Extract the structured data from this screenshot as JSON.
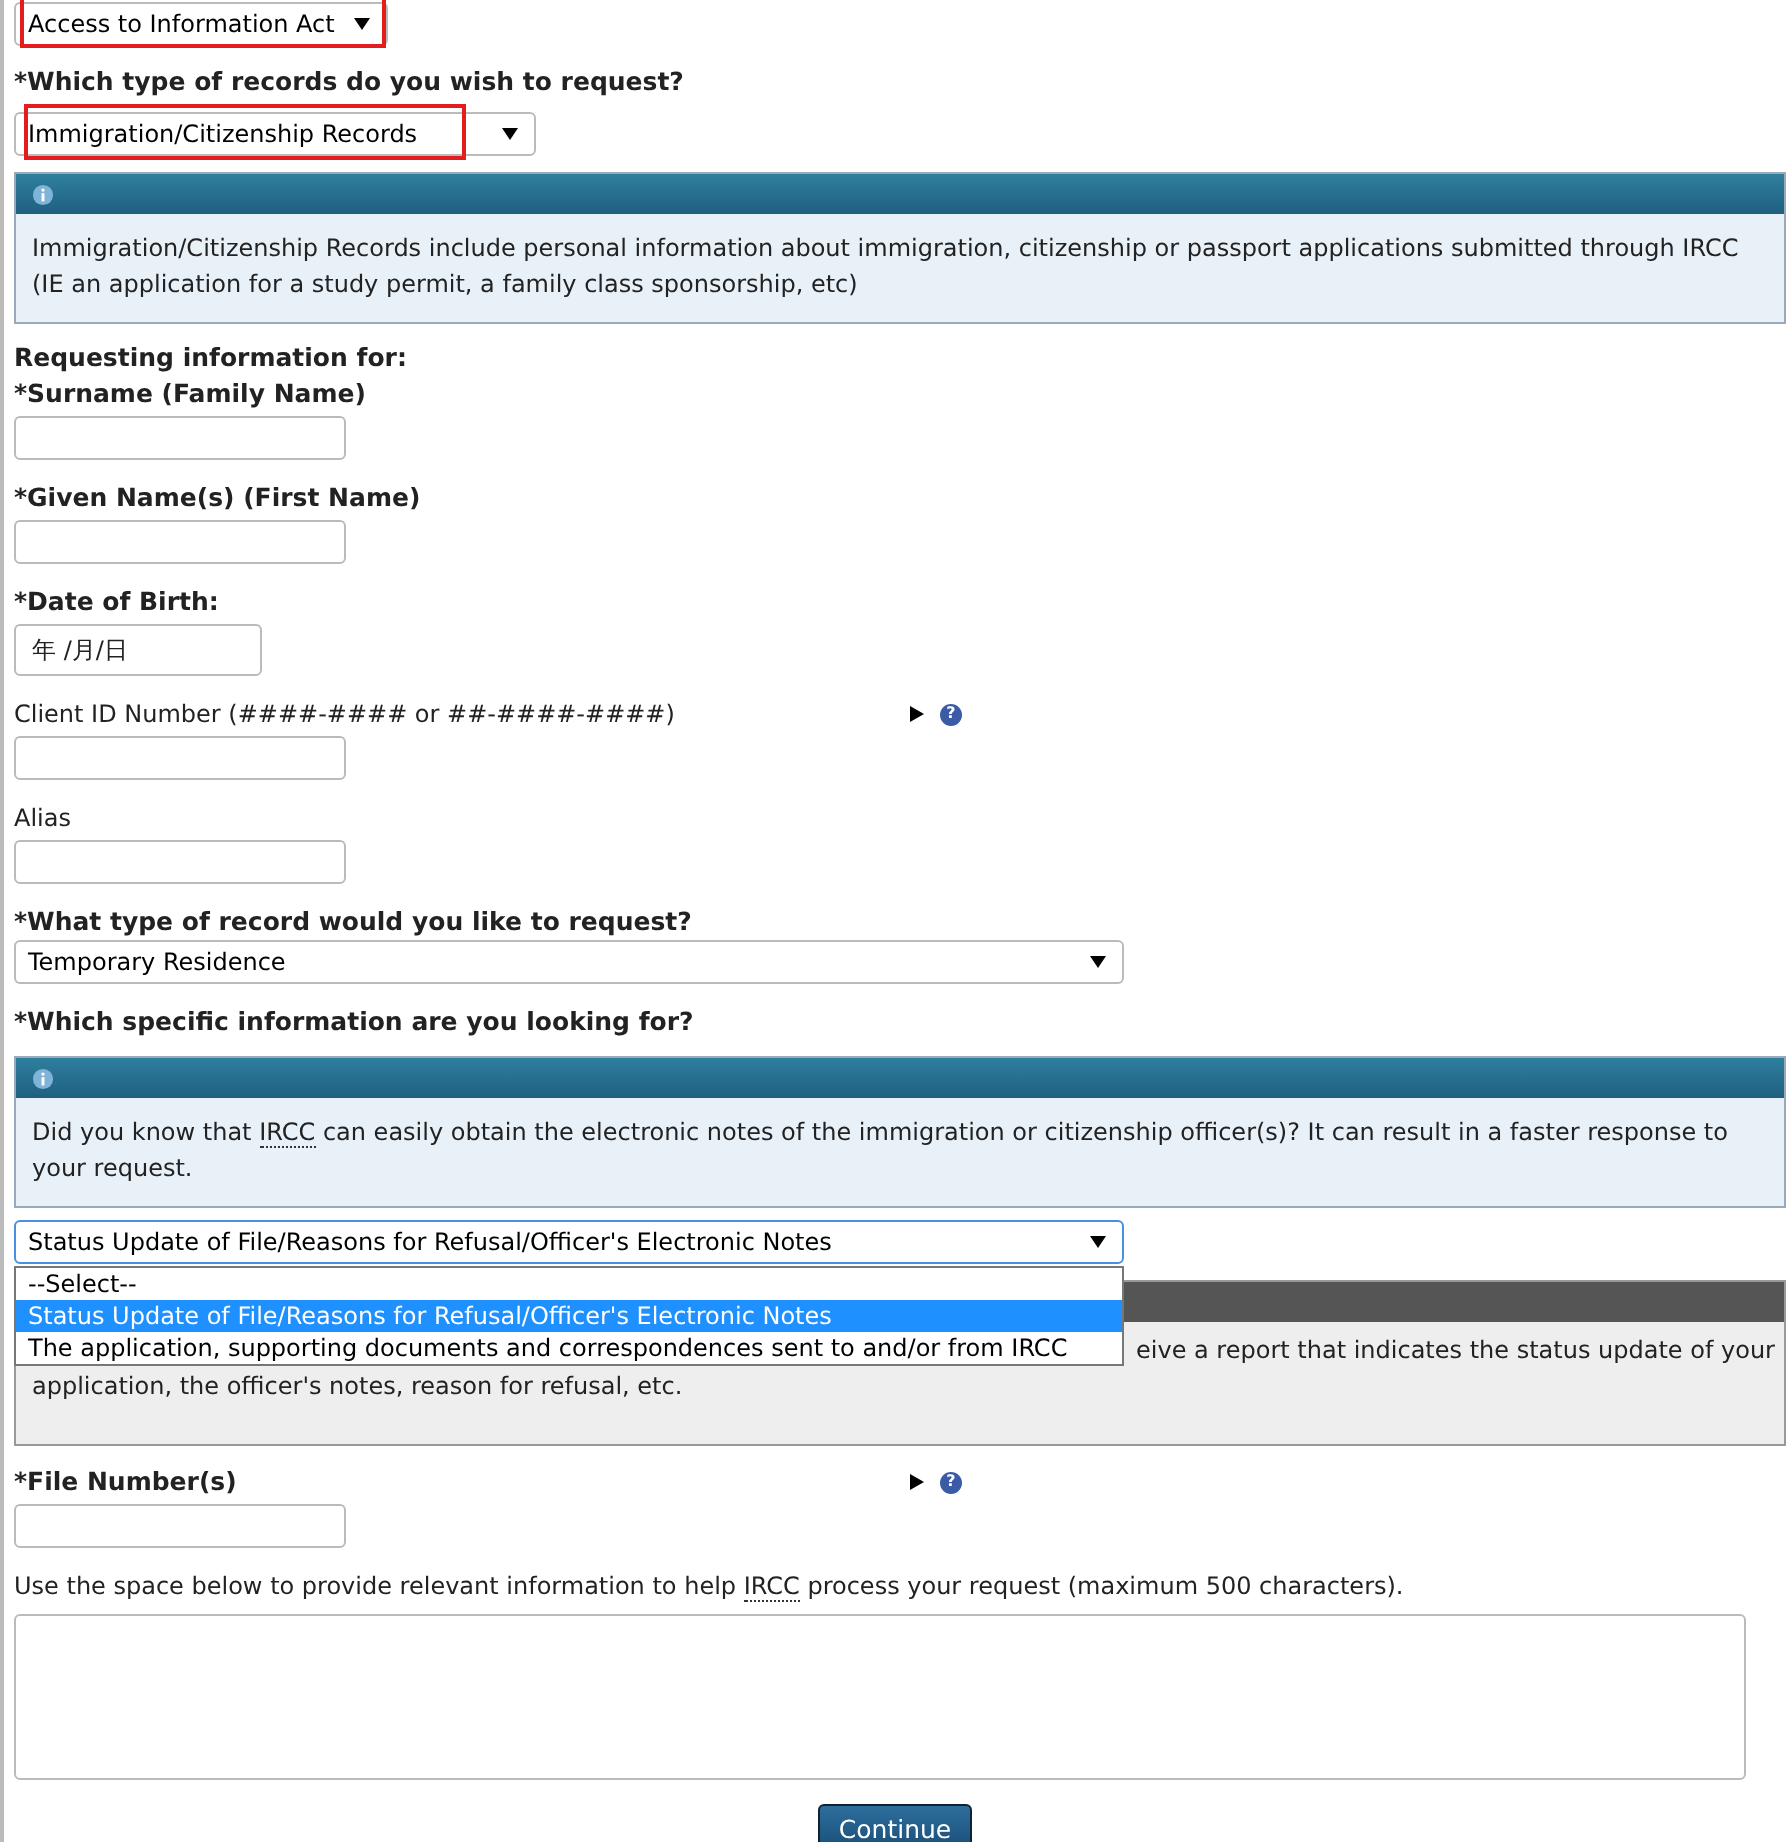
{
  "program_select": {
    "value": "Access to Information Act",
    "highlighted": true
  },
  "records_question": "*Which type of records do you wish to request?",
  "records_select": {
    "value": "Immigration/Citizenship Records",
    "highlighted": true
  },
  "records_info": "Immigration/Citizenship Records include personal information about immigration, citizenship or passport applications submitted through IRCC (IE an application for a study permit, a family class sponsorship, etc)",
  "requesting_heading": "Requesting information for:",
  "fields": [
    {
      "kind": "input",
      "label": "*Surname (Family Name)",
      "required": true
    },
    {
      "kind": "input",
      "label": "*Given Name(s) (First Name)",
      "required": true
    },
    {
      "kind": "date",
      "label": "*Date of Birth:",
      "required": true,
      "placeholder": "年 /月/日"
    },
    {
      "kind": "input",
      "label": "Client ID Number (####-#### or ##-####-####)",
      "required": false,
      "help": "?"
    },
    {
      "kind": "input",
      "label": "Alias",
      "required": false
    },
    {
      "kind": "select",
      "label": "*What type of record would you like to request?",
      "required": true,
      "value": "Temporary Residence"
    }
  ],
  "specific_question": "*Which specific information are you looking for?",
  "specific_info": [
    {
      "text": "Did you know that ",
      "abbr": false
    },
    {
      "text": "IRCC",
      "abbr": true
    },
    {
      "text": " can easily obtain the electronic notes of the immigration or citizenship officer(s)? It can result in a faster response to your request.",
      "abbr": false
    }
  ],
  "specific_select": {
    "value": "Status Update of File/Reasons for Refusal/Officer's Electronic Notes",
    "expanded": true,
    "options": [
      {
        "label": "--Select--",
        "selected": false
      },
      {
        "label": "Status Update of File/Reasons for Refusal/Officer's Electronic Notes",
        "selected": true
      },
      {
        "label": "The application, supporting documents and correspondences sent to and/or from IRCC",
        "selected": false
      }
    ]
  },
  "notes_info": {
    "partial_line": "eive a report that indicates the status update of your",
    "text": "application, the officer's notes, reason for refusal, etc."
  },
  "file_number": {
    "label": "*File Number(s)",
    "help": "?"
  },
  "description": [
    {
      "text": "Use the space below to provide relevant information to help ",
      "abbr": false
    },
    {
      "text": "IRCC",
      "abbr": true
    },
    {
      "text": " process your request (maximum 500 characters).",
      "abbr": false
    }
  ],
  "continue_button": "Continue"
}
